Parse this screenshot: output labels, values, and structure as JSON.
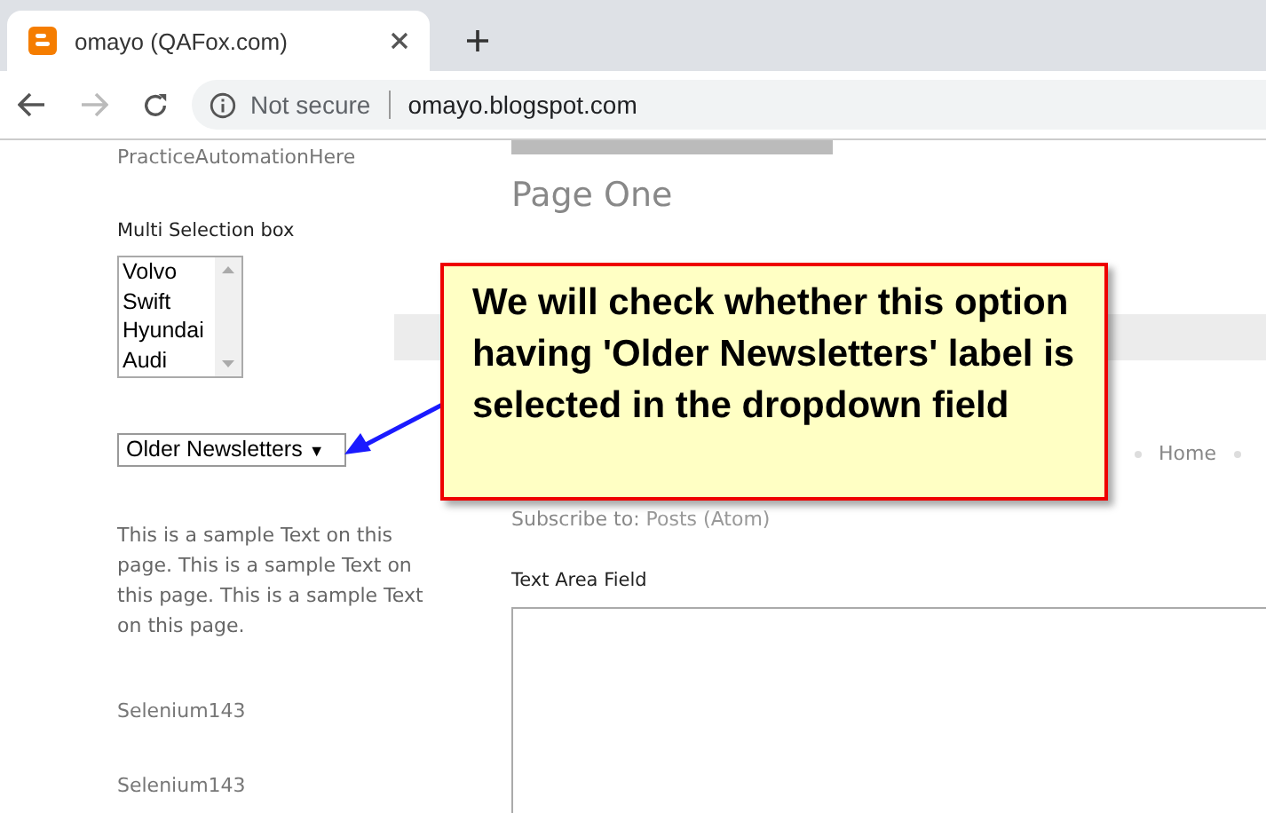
{
  "browser": {
    "tab": {
      "title": "omayo (QAFox.com)"
    },
    "address": {
      "security": "Not secure",
      "url": "omayo.blogspot.com"
    }
  },
  "sidebar": {
    "heading": "PracticeAutomationHere",
    "multi_select": {
      "label": "Multi Selection box",
      "options": [
        "Volvo",
        "Swift",
        "Hyundai",
        "Audi"
      ]
    },
    "dropdown": {
      "value": "Older Newsletters",
      "caret": "▼"
    },
    "paragraph": "This is a sample Text on this page. This is a sample Text on this page. This is a sample Text on this page.",
    "links": [
      "Selenium143",
      "Selenium143"
    ]
  },
  "main": {
    "post_title": "Page One",
    "nav_link": "Home",
    "subscribe": {
      "label": "Subscribe to:",
      "link": "Posts (Atom)"
    },
    "text_area": {
      "label": "Text Area Field"
    }
  },
  "callout": {
    "text": "We will check whether this option having 'Older Newsletters' label is selected in the dropdown field"
  }
}
